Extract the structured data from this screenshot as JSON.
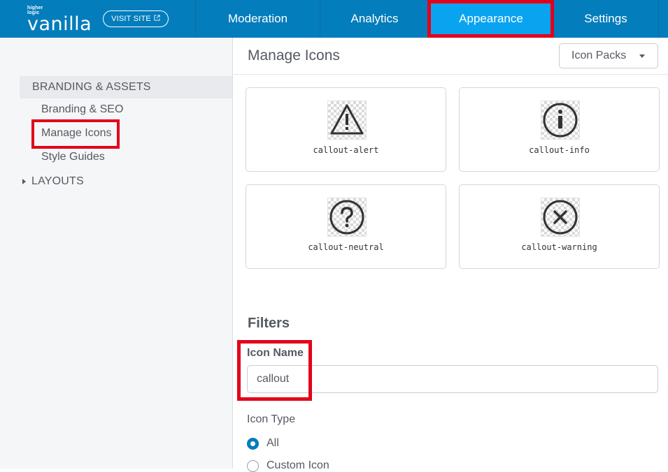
{
  "brand": {
    "small_top": "higher",
    "small_bottom": "logic",
    "name": "vanilla"
  },
  "topbar": {
    "visit_site": "VISIT SITE",
    "nav": [
      {
        "label": "Moderation"
      },
      {
        "label": "Analytics"
      },
      {
        "label": "Appearance",
        "active": true
      },
      {
        "label": "Settings"
      }
    ]
  },
  "sidebar": {
    "section": "BRANDING & ASSETS",
    "items": [
      {
        "label": "Branding & SEO"
      },
      {
        "label": "Manage Icons",
        "active": true
      },
      {
        "label": "Style Guides"
      }
    ],
    "collapsed_section": "LAYOUTS"
  },
  "main": {
    "title": "Manage Icons",
    "icon_packs_label": "Icon Packs",
    "icons": [
      {
        "name": "callout-alert",
        "icon": "warning-triangle-icon"
      },
      {
        "name": "callout-info",
        "icon": "info-circle-icon"
      },
      {
        "name": "callout-neutral",
        "icon": "question-circle-icon"
      },
      {
        "name": "callout-warning",
        "icon": "x-circle-icon"
      }
    ],
    "filters": {
      "title": "Filters",
      "icon_name_label": "Icon Name",
      "icon_name_value": "callout",
      "icon_type_label": "Icon Type",
      "options": [
        {
          "label": "All",
          "checked": true
        },
        {
          "label": "Custom Icon",
          "checked": false
        }
      ]
    }
  },
  "colors": {
    "topbar": "#037dbc",
    "nav_active": "#0aa3f0",
    "highlight": "#e3001b"
  }
}
